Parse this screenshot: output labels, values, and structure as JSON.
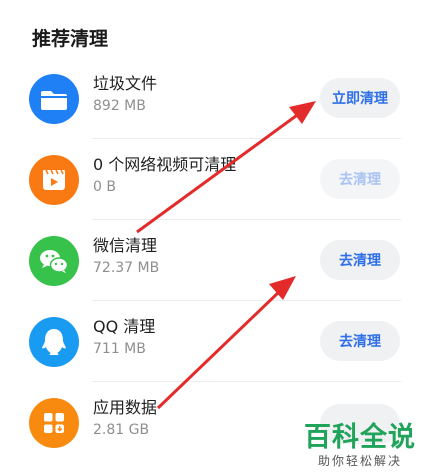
{
  "section_title": "推荐清理",
  "items": [
    {
      "name": "垃圾文件",
      "size": "892 MB",
      "button": "立即清理",
      "icon": "folder-icon",
      "color": "#1f80f5",
      "enabled": true
    },
    {
      "name": "0 个网络视频可清理",
      "size": "0 B",
      "button": "去清理",
      "icon": "video-icon",
      "color": "#f97a12",
      "enabled": false
    },
    {
      "name": "微信清理",
      "size": "72.37 MB",
      "button": "去清理",
      "icon": "wechat-icon",
      "color": "#36c24b",
      "enabled": true
    },
    {
      "name": "QQ 清理",
      "size": "711 MB",
      "button": "去清理",
      "icon": "qq-icon",
      "color": "#1a9bf2",
      "enabled": true
    },
    {
      "name": "应用数据",
      "size": "2.81 GB",
      "button": "",
      "icon": "apps-icon",
      "color": "#f98a10",
      "enabled": true
    }
  ],
  "watermark": {
    "main": "百科全说",
    "sub": "助你轻松解决"
  },
  "colors": {
    "accent": "#2f6fe8",
    "arrow": "#e32b2b"
  }
}
